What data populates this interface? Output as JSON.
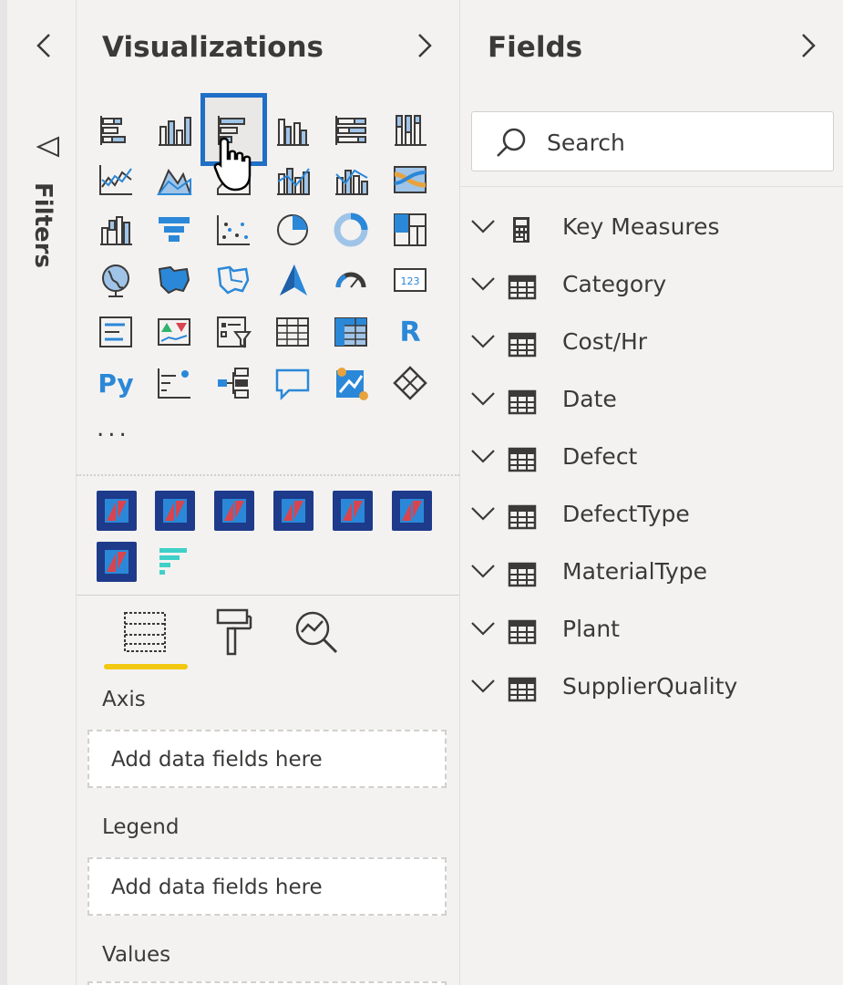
{
  "filters": {
    "label": "Filters"
  },
  "visualizations": {
    "title": "Visualizations",
    "more_label": "...",
    "r_label": "R",
    "py_label": "Py",
    "tabs": [
      "fields-tab",
      "format-tab",
      "analytics-tab"
    ],
    "wells": [
      {
        "label": "Axis",
        "placeholder": "Add data fields here"
      },
      {
        "label": "Legend",
        "placeholder": "Add data fields here"
      },
      {
        "label": "Values"
      }
    ]
  },
  "fields": {
    "title": "Fields",
    "search_placeholder": "Search",
    "tables": [
      {
        "name": "Key Measures",
        "icon": "calculator-icon"
      },
      {
        "name": "Category",
        "icon": "table-icon"
      },
      {
        "name": "Cost/Hr",
        "icon": "table-icon"
      },
      {
        "name": "Date",
        "icon": "table-icon"
      },
      {
        "name": "Defect",
        "icon": "table-icon"
      },
      {
        "name": "DefectType",
        "icon": "table-icon"
      },
      {
        "name": "MaterialType",
        "icon": "table-icon"
      },
      {
        "name": "Plant",
        "icon": "table-icon"
      },
      {
        "name": "SupplierQuality",
        "icon": "table-icon"
      }
    ]
  },
  "colors": {
    "accent_blue": "#1f6fc6",
    "tab_underline": "#f2c811",
    "icon_dark": "#3b3a39",
    "icon_blue": "#2b88d8"
  }
}
